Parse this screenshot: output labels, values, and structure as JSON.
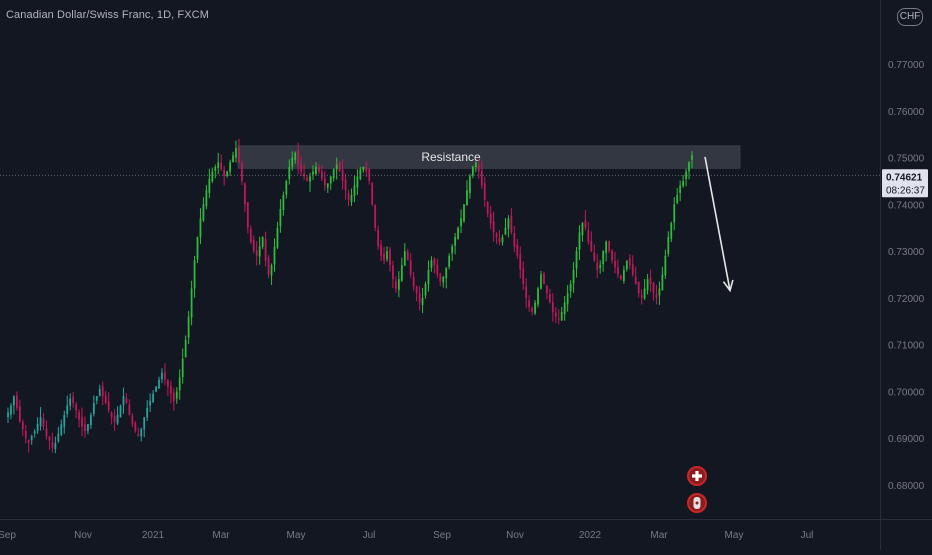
{
  "header": {
    "symbol_title": "Canadian Dollar/Swiss Franc, 1D, FXCM",
    "currency": "CHF"
  },
  "colors": {
    "background": "#131722",
    "up": "#26a69a",
    "up_bright": "#2ebd3a",
    "down": "#c2185b",
    "zone": "#3a3d47",
    "axis_text": "#787b86",
    "price_tag": "#e0e3eb",
    "arrow": "#e6e6e6"
  },
  "chart_data": {
    "type": "candlestick",
    "x_ticks": [
      "Sep",
      "Nov",
      "2021",
      "Mar",
      "May",
      "Jul",
      "Sep",
      "Nov",
      "2022",
      "Mar",
      "May",
      "Jul"
    ],
    "y_ticks": [
      "0.77000",
      "0.76000",
      "0.75000",
      "0.74000",
      "0.73000",
      "0.72000",
      "0.71000",
      "0.70000",
      "0.69000",
      "0.68000"
    ],
    "ylim": [
      0.6765,
      0.7818
    ],
    "current_price": "0.74621",
    "countdown": "08:26:37",
    "resistance_zone": {
      "label": "Resistance",
      "low": 0.7477,
      "high": 0.7525
    },
    "projection": {
      "from": 0.748,
      "to": 0.722
    },
    "series_close": [
      0.6955,
      0.697,
      0.699,
      0.6965,
      0.6935,
      0.692,
      0.69,
      0.689,
      0.6905,
      0.6915,
      0.693,
      0.6945,
      0.6925,
      0.6905,
      0.6895,
      0.688,
      0.689,
      0.691,
      0.693,
      0.695,
      0.697,
      0.6985,
      0.6975,
      0.696,
      0.694,
      0.6925,
      0.6915,
      0.693,
      0.695,
      0.6975,
      0.699,
      0.7005,
      0.699,
      0.6975,
      0.696,
      0.6945,
      0.6935,
      0.695,
      0.697,
      0.699,
      0.6975,
      0.695,
      0.693,
      0.6915,
      0.6905,
      0.692,
      0.6945,
      0.6965,
      0.698,
      0.6995,
      0.701,
      0.7025,
      0.704,
      0.7025,
      0.701,
      0.6995,
      0.698,
      0.7,
      0.703,
      0.707,
      0.711,
      0.716,
      0.722,
      0.728,
      0.733,
      0.737,
      0.74,
      0.743,
      0.7455,
      0.747,
      0.748,
      0.749,
      0.7475,
      0.746,
      0.747,
      0.749,
      0.7505,
      0.752,
      0.749,
      0.745,
      0.74,
      0.735,
      0.732,
      0.73,
      0.729,
      0.731,
      0.733,
      0.728,
      0.725,
      0.727,
      0.731,
      0.735,
      0.739,
      0.742,
      0.745,
      0.748,
      0.75,
      0.751,
      0.7485,
      0.747,
      0.746,
      0.745,
      0.746,
      0.747,
      0.748,
      0.747,
      0.7455,
      0.744,
      0.7445,
      0.746,
      0.7475,
      0.7485,
      0.747,
      0.745,
      0.743,
      0.741,
      0.742,
      0.744,
      0.746,
      0.7475,
      0.748,
      0.747,
      0.745,
      0.74,
      0.735,
      0.731,
      0.729,
      0.728,
      0.73,
      0.727,
      0.724,
      0.722,
      0.724,
      0.727,
      0.73,
      0.728,
      0.725,
      0.7225,
      0.721,
      0.719,
      0.72,
      0.723,
      0.726,
      0.728,
      0.727,
      0.725,
      0.7235,
      0.7245,
      0.7265,
      0.729,
      0.731,
      0.733,
      0.735,
      0.737,
      0.74,
      0.743,
      0.746,
      0.748,
      0.749,
      0.747,
      0.744,
      0.741,
      0.738,
      0.736,
      0.734,
      0.733,
      0.732,
      0.733,
      0.735,
      0.737,
      0.734,
      0.731,
      0.729,
      0.726,
      0.723,
      0.72,
      0.718,
      0.717,
      0.719,
      0.722,
      0.725,
      0.723,
      0.721,
      0.719,
      0.717,
      0.716,
      0.7155,
      0.717,
      0.719,
      0.721,
      0.723,
      0.726,
      0.73,
      0.734,
      0.736,
      0.735,
      0.732,
      0.73,
      0.728,
      0.726,
      0.727,
      0.73,
      0.732,
      0.73,
      0.728,
      0.7265,
      0.725,
      0.724,
      0.726,
      0.728,
      0.727,
      0.725,
      0.723,
      0.721,
      0.72,
      0.722,
      0.724,
      0.723,
      0.721,
      0.72,
      0.722,
      0.725,
      0.729,
      0.733,
      0.736,
      0.74,
      0.742,
      0.744,
      0.745,
      0.747,
      0.749,
      0.7505
    ]
  },
  "events": [
    {
      "id": "flag-event",
      "icon": "swiss-flag-icon"
    },
    {
      "id": "coin-event",
      "icon": "coin-icon"
    }
  ]
}
